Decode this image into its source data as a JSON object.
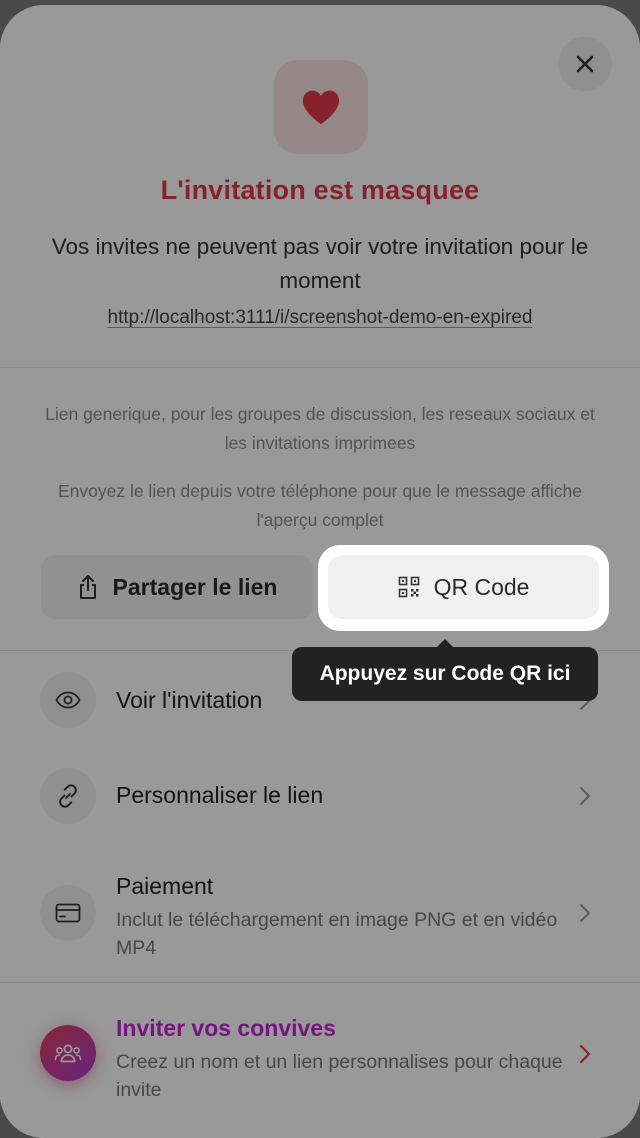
{
  "header": {
    "close_icon": "close-icon",
    "heart_icon": "heart-icon",
    "title": "L'invitation est masquee",
    "subtitle": "Vos invites ne peuvent pas voir votre invitation pour le moment",
    "url": "http://localhost:3111/i/screenshot-demo-en-expired"
  },
  "share": {
    "description1": "Lien generique, pour les groupes de discussion, les reseaux sociaux et les invitations imprimees",
    "description2": "Envoyez le lien depuis votre téléphone pour que le message affiche l'aperçu complet",
    "share_label": "Partager le lien",
    "qr_label": "QR Code"
  },
  "tooltip": {
    "text": "Appuyez sur Code QR ici"
  },
  "menu": {
    "view": {
      "label": "Voir l'invitation",
      "icon": "eye-icon"
    },
    "customize": {
      "label": "Personnaliser le lien",
      "icon": "link-icon"
    },
    "payment": {
      "label": "Paiement",
      "sub": "Inclut le téléchargement en image PNG et en vidéo MP4",
      "icon": "credit-card-icon"
    },
    "invite": {
      "label": "Inviter vos convives",
      "sub": "Creez un nom et un lien personnalises pour chaque invite",
      "icon": "users-icon"
    }
  },
  "colors": {
    "accent_red": "#e03a48",
    "invite_purple": "#c026d3",
    "invite_gradient_start": "#e53e5b",
    "invite_gradient_end": "#a93fd6"
  }
}
